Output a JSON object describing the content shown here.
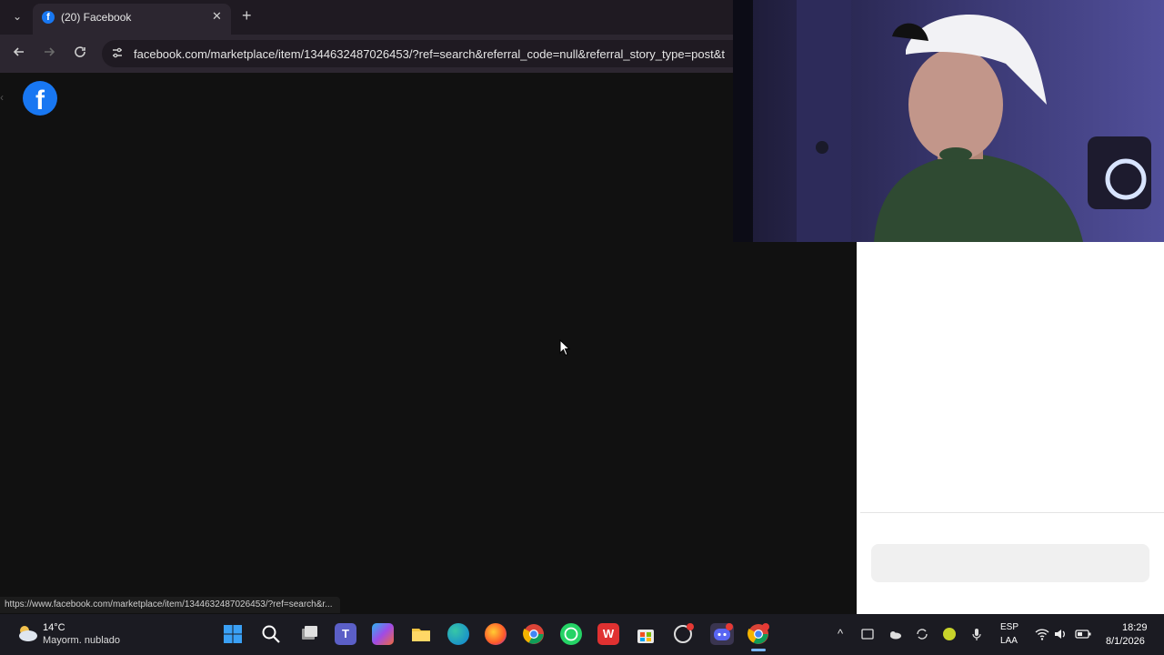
{
  "browser": {
    "tab": {
      "title": "(20) Facebook",
      "favicon_letter": "f",
      "close_label": "✕"
    },
    "new_tab_label": "+",
    "tab_dropdown_label": "⌄",
    "url": "facebook.com/marketplace/item/1344632487026453/?ref=search&referral_code=null&referral_story_type=post&t",
    "status_url": "https://www.facebook.com/marketplace/item/1344632487026453/?ref=search&r..."
  },
  "page": {
    "logo_letter": "f",
    "colors": {
      "facebook_blue": "#1877f2",
      "page_bg": "#111111"
    }
  },
  "taskbar": {
    "weather": {
      "temp": "14°C",
      "desc": "Mayorm. nublado"
    },
    "apps": [
      {
        "name": "windows-start-icon"
      },
      {
        "name": "search-icon"
      },
      {
        "name": "task-view-icon"
      },
      {
        "name": "teams-icon"
      },
      {
        "name": "copilot-icon"
      },
      {
        "name": "file-explorer-icon"
      },
      {
        "name": "edge-icon"
      },
      {
        "name": "firefox-icon"
      },
      {
        "name": "chrome-icon"
      },
      {
        "name": "whatsapp-icon"
      },
      {
        "name": "wps-icon",
        "letter": "W"
      },
      {
        "name": "store-icon"
      },
      {
        "name": "capcut-icon"
      },
      {
        "name": "discord-icon"
      },
      {
        "name": "chrome-active-icon"
      }
    ],
    "language": {
      "line1": "ESP",
      "line2": "LAA"
    },
    "clock": {
      "time": "18:29",
      "date": "8/1/2026"
    }
  }
}
